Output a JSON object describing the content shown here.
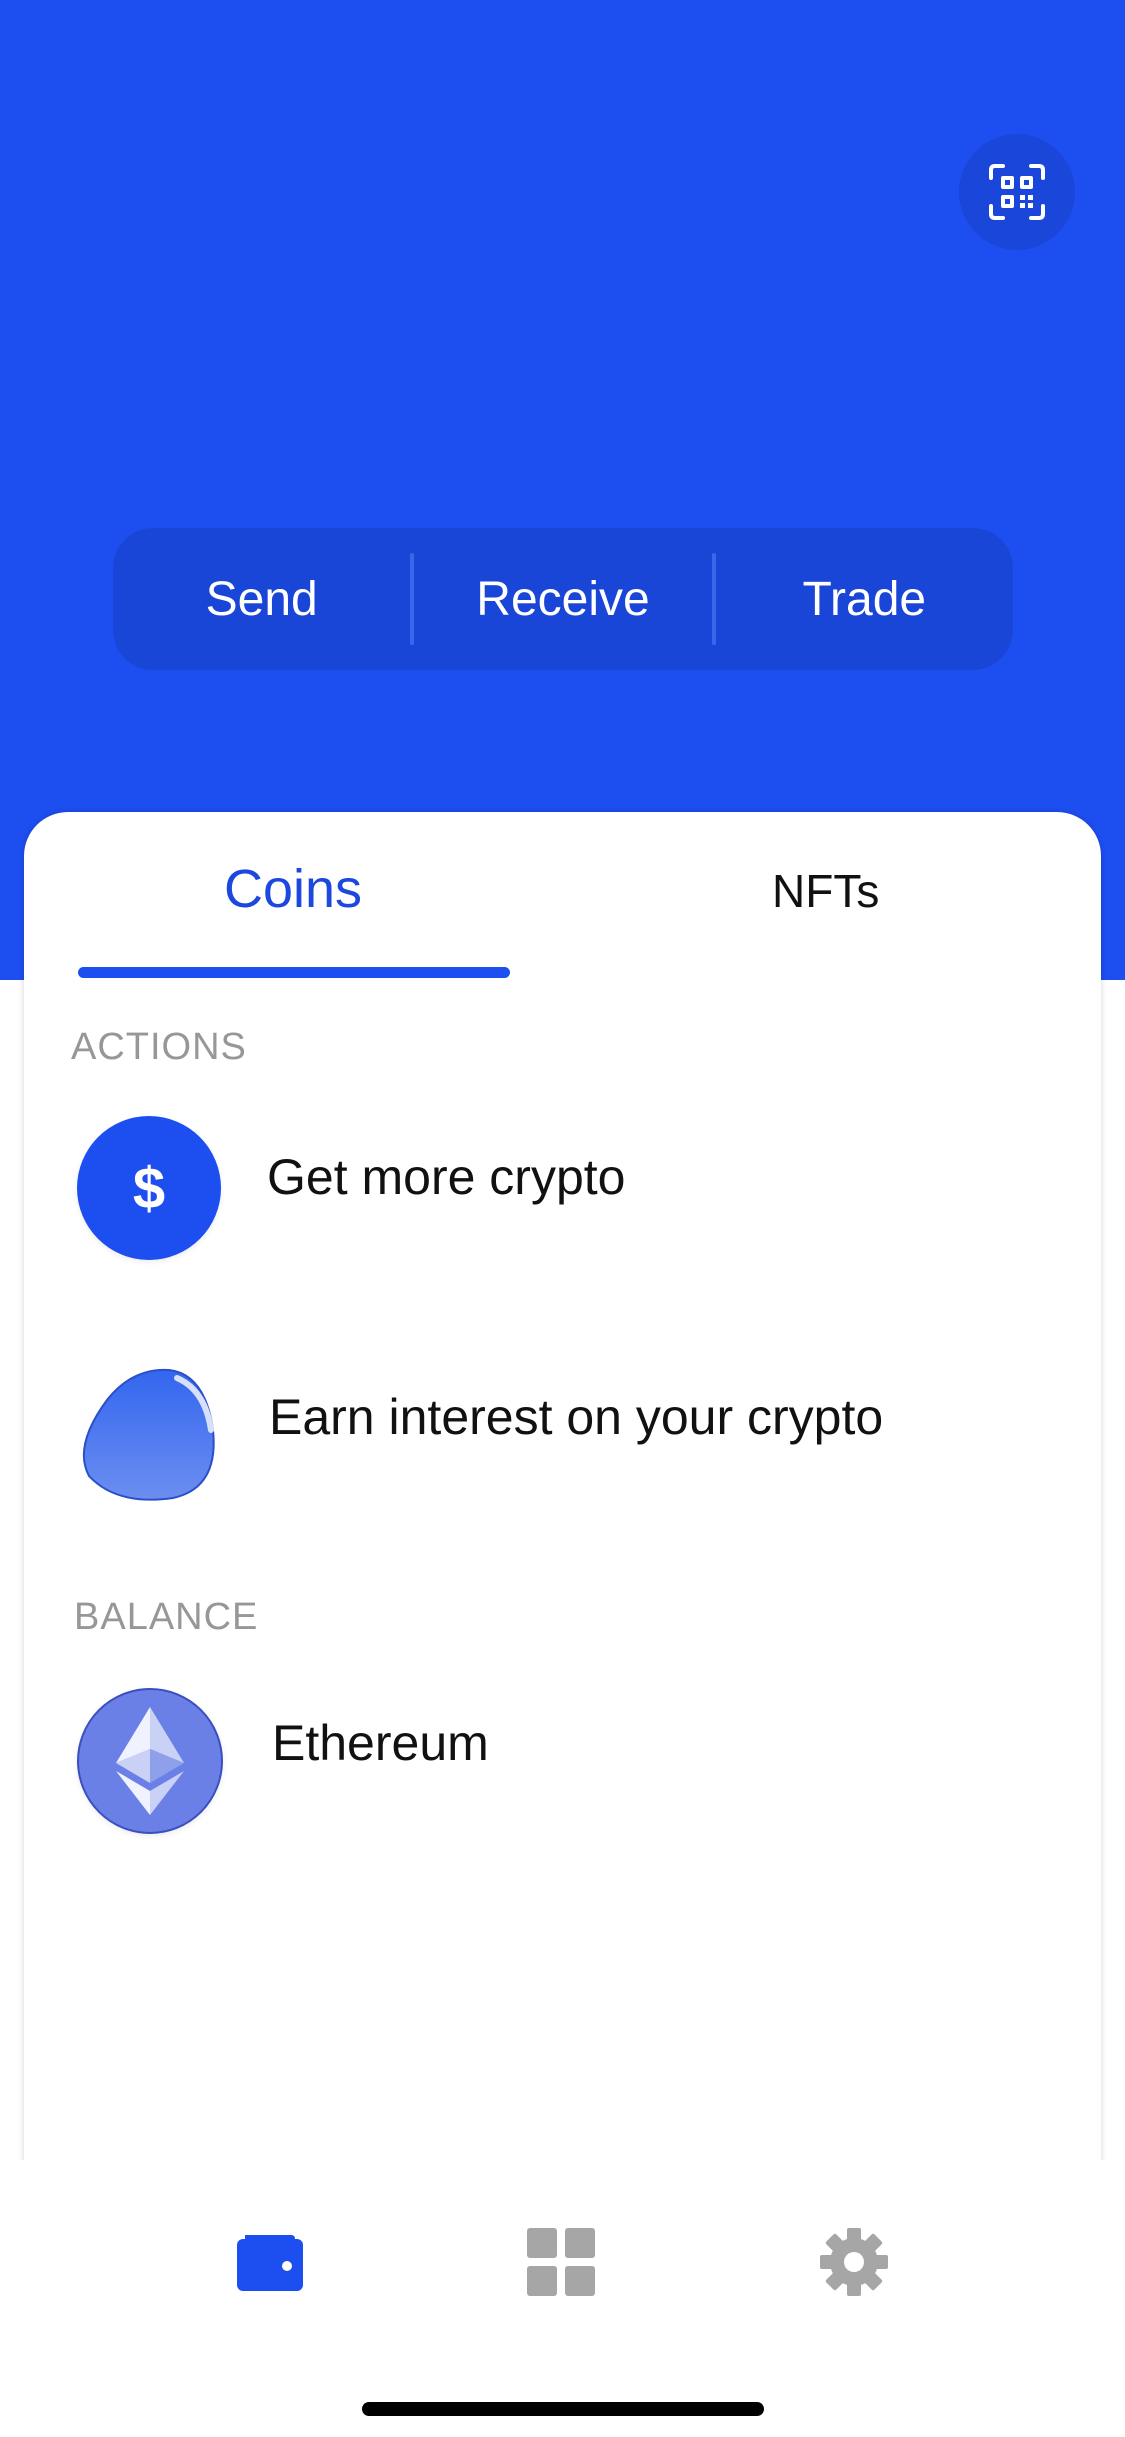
{
  "colors": {
    "brand": "#1d4ef0",
    "tab_active": "#1c48df",
    "section_label": "#979797",
    "nav_inactive": "#a6a6a6"
  },
  "header": {
    "scan_icon": "qr-scan-icon"
  },
  "actions_bar": {
    "send": "Send",
    "receive": "Receive",
    "trade": "Trade"
  },
  "tabs": {
    "coins": "Coins",
    "nfts": "NFTs"
  },
  "actions_section": {
    "label": "ACTIONS",
    "items": [
      {
        "label": "Get more crypto",
        "icon": "dollar-icon"
      },
      {
        "label": "Earn interest on your crypto",
        "icon": "blob-icon"
      }
    ]
  },
  "balance_section": {
    "label": "BALANCE",
    "items": [
      {
        "label": "Ethereum",
        "icon": "ethereum-icon"
      }
    ]
  },
  "bottom_nav": {
    "items": [
      {
        "icon": "wallet-icon",
        "active": true
      },
      {
        "icon": "grid-icon",
        "active": false
      },
      {
        "icon": "gear-icon",
        "active": false
      }
    ]
  }
}
